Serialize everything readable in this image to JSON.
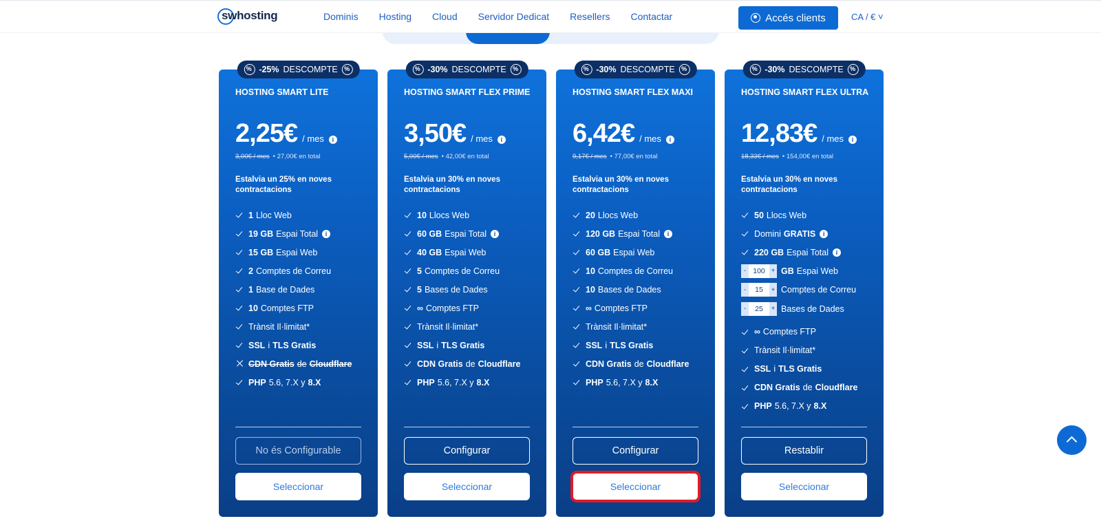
{
  "header": {
    "logo": "swhosting",
    "nav": [
      "Dominis",
      "Hosting",
      "Cloud",
      "Servidor Dedicat",
      "Resellers",
      "Contactar"
    ],
    "clients_label": "Accés clients",
    "lang": "CA / €"
  },
  "plans": [
    {
      "badge_pct": "-25%",
      "badge_text": "DESCOMPTE",
      "name": "HOSTING SMART LITE",
      "price": "2,25€",
      "per": "/ mes",
      "old_price": "3,00€ / mes",
      "total": "27,00€ en total",
      "save": "Estalvia un 25% en noves contractacions",
      "features": [
        {
          "b": "1",
          "t": "Lloc Web"
        },
        {
          "b": "19 GB",
          "t": "Espai Total",
          "info": true
        },
        {
          "b": "15 GB",
          "t": "Espai Web"
        },
        {
          "b": "2",
          "t": "Comptes de Correu"
        },
        {
          "b": "1",
          "t": "Base de Dades"
        },
        {
          "b": "10",
          "t": "Comptes FTP"
        },
        {
          "t": "Trànsit Il·limitat*"
        },
        {
          "b": "SSL",
          "t": "i",
          "b2": "TLS Gratis"
        },
        {
          "b": "CDN Gratis",
          "t": "de",
          "b2": "Cloudflare",
          "excluded": true
        },
        {
          "b": "PHP",
          "t": "5.6, 7.X y",
          "b2": "8.X"
        }
      ],
      "config_label": "No és Configurable",
      "config_disabled": true,
      "select_label": "Seleccionar"
    },
    {
      "badge_pct": "-30%",
      "badge_text": "DESCOMPTE",
      "name": "HOSTING SMART FLEX PRIME",
      "price": "3,50€",
      "per": "/ mes",
      "old_price": "5,00€ / mes",
      "total": "42,00€ en total",
      "save": "Estalvia un 30% en noves contractacions",
      "features": [
        {
          "b": "10",
          "t": "Llocs Web"
        },
        {
          "b": "60 GB",
          "t": "Espai Total",
          "info": true
        },
        {
          "b": "40 GB",
          "t": "Espai Web"
        },
        {
          "b": "5",
          "t": "Comptes de Correu"
        },
        {
          "b": "5",
          "t": "Bases de Dades"
        },
        {
          "b": "∞",
          "t": "Comptes FTP"
        },
        {
          "t": "Trànsit Il·limitat*"
        },
        {
          "b": "SSL",
          "t": "i",
          "b2": "TLS Gratis"
        },
        {
          "b": "CDN Gratis",
          "t": "de",
          "b2": "Cloudflare"
        },
        {
          "b": "PHP",
          "t": "5.6, 7.X y",
          "b2": "8.X"
        }
      ],
      "config_label": "Configurar",
      "select_label": "Seleccionar"
    },
    {
      "badge_pct": "-30%",
      "badge_text": "DESCOMPTE",
      "name": "HOSTING SMART FLEX MAXI",
      "price": "6,42€",
      "per": "/ mes",
      "old_price": "9,17€ / mes",
      "total": "77,00€ en total",
      "save": "Estalvia un 30% en noves contractacions",
      "features": [
        {
          "b": "20",
          "t": "Llocs Web"
        },
        {
          "b": "120 GB",
          "t": "Espai Total",
          "info": true
        },
        {
          "b": "60 GB",
          "t": "Espai Web"
        },
        {
          "b": "10",
          "t": "Comptes de Correu"
        },
        {
          "b": "10",
          "t": "Bases de Dades"
        },
        {
          "b": "∞",
          "t": "Comptes FTP"
        },
        {
          "t": "Trànsit Il·limitat*"
        },
        {
          "b": "SSL",
          "t": "i",
          "b2": "TLS Gratis"
        },
        {
          "b": "CDN Gratis",
          "t": "de",
          "b2": "Cloudflare"
        },
        {
          "b": "PHP",
          "t": "5.6, 7.X y",
          "b2": "8.X"
        }
      ],
      "config_label": "Configurar",
      "select_label": "Seleccionar",
      "highlighted": true
    },
    {
      "badge_pct": "-30%",
      "badge_text": "DESCOMPTE",
      "name": "HOSTING SMART FLEX ULTRA",
      "price": "12,83€",
      "per": "/ mes",
      "old_price": "18,33€ / mes",
      "total": "154,00€ en total",
      "save": "Estalvia un 30% en noves contractacions",
      "features": [
        {
          "b": "50",
          "t": "Llocs Web"
        },
        {
          "t": "Domini",
          "b2": "GRATIS",
          "info": true
        },
        {
          "b": "220 GB",
          "t": "Espai Total",
          "info": true
        },
        {
          "stepper": "100",
          "b": "GB",
          "t": "Espai Web"
        },
        {
          "stepper": "15",
          "t": "Comptes de Correu"
        },
        {
          "stepper": "25",
          "t": "Bases de Dades"
        },
        {
          "b": "∞",
          "t": "Comptes FTP"
        },
        {
          "t": "Trànsit Il·limitat*"
        },
        {
          "b": "SSL",
          "t": "i",
          "b2": "TLS Gratis"
        },
        {
          "b": "CDN Gratis",
          "t": "de",
          "b2": "Cloudflare"
        },
        {
          "b": "PHP",
          "t": "5.6, 7.X y",
          "b2": "8.X"
        }
      ],
      "config_label": "Restablir",
      "select_label": "Seleccionar"
    }
  ]
}
